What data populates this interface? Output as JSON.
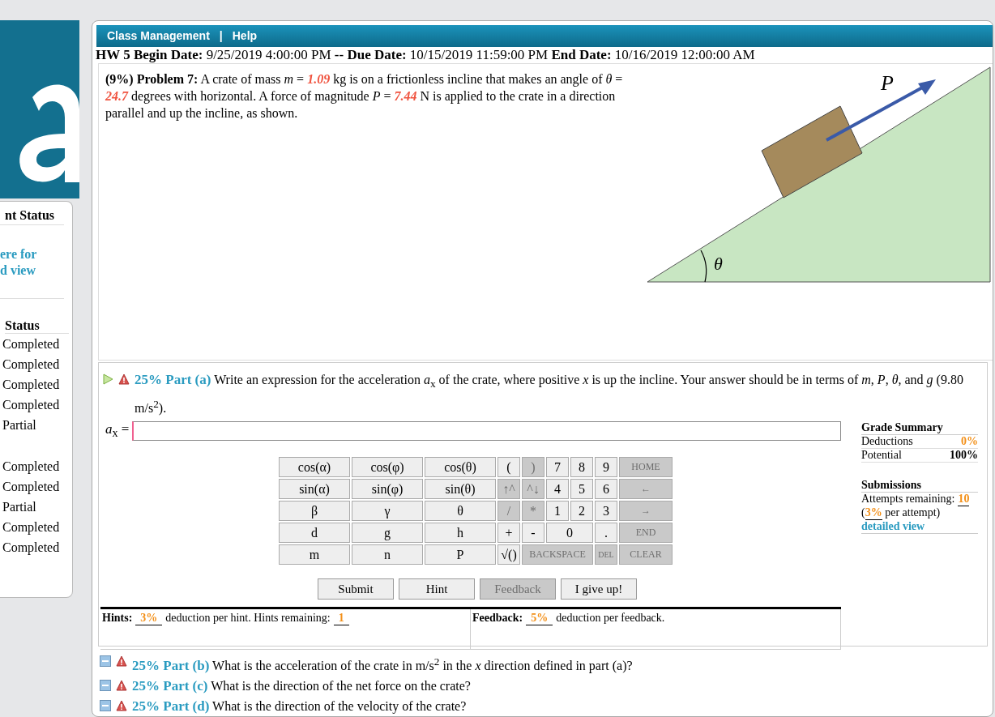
{
  "nav": {
    "items": [
      "Class Management",
      "Help"
    ],
    "separator": "|"
  },
  "sidebar": {
    "heading": "nt Status",
    "link_lines": [
      "ere for",
      "d view"
    ],
    "status_heading": "Status",
    "status_groups": [
      [
        "Completed",
        "Completed",
        "Completed",
        "Completed",
        "Partial"
      ],
      [
        "Completed",
        "Completed",
        "Partial",
        "Completed",
        "Completed"
      ]
    ]
  },
  "hw_header": "**HW 5 Begin Date:** 9/25/2019 4:00:00 PM **-- Due Date:** 10/15/2019 11:59:00 PM **End Date:** 10/16/2019 12:00:00 AM",
  "problem": {
    "segments": [
      {
        "kind": "text",
        "text": "**(9%)  Problem 7:**   A crate of mass *m* = "
      },
      {
        "kind": "given",
        "text": "1.09"
      },
      {
        "kind": "text",
        "text": " kg is on a frictionless incline that makes an angle of *θ* = "
      },
      {
        "kind": "given",
        "text": "24.7"
      },
      {
        "kind": "text",
        "text": " degrees with horizontal. A force of magnitude *P* = "
      },
      {
        "kind": "given",
        "text": "7.44"
      },
      {
        "kind": "text",
        "text": " N is applied to the crate in a direction parallel and up the incline, as shown."
      }
    ],
    "diagram": {
      "force_label": "P",
      "angle_label": "θ"
    }
  },
  "parts": [
    {
      "title": "25% Part (a)",
      "prompt": "Write an expression for the acceleration *a*$_{x}$ of the crate, where positive *x* is up the incline. Your answer should be in terms of *m*, *P*, *θ*, and *g* (9.80 m/s$^{2}$).",
      "expanded": true,
      "answer": {
        "label": "*a*$_{x}$ =",
        "keypad": [
          [
            {
              "label": "cos(α)",
              "kind": "key",
              "disabled": false
            },
            {
              "label": "cos(φ)",
              "kind": "key",
              "disabled": false
            },
            {
              "label": "cos(θ)",
              "kind": "key",
              "disabled": false
            },
            {
              "label": "(",
              "kind": "key",
              "disabled": false
            },
            {
              "label": ")",
              "kind": "key",
              "disabled": true
            },
            {
              "label": "7",
              "kind": "key",
              "disabled": false
            },
            {
              "label": "8",
              "kind": "key",
              "disabled": false
            },
            {
              "label": "9",
              "kind": "key",
              "disabled": false
            },
            {
              "label": "HOME",
              "kind": "word",
              "disabled": true
            }
          ],
          [
            {
              "label": "sin(α)",
              "kind": "key",
              "disabled": false
            },
            {
              "label": "sin(φ)",
              "kind": "key",
              "disabled": false
            },
            {
              "label": "sin(θ)",
              "kind": "key",
              "disabled": false
            },
            {
              "label": "↑^",
              "kind": "key",
              "disabled": true
            },
            {
              "label": "^↓",
              "kind": "key",
              "disabled": true
            },
            {
              "label": "4",
              "kind": "key",
              "disabled": false
            },
            {
              "label": "5",
              "kind": "key",
              "disabled": false
            },
            {
              "label": "6",
              "kind": "key",
              "disabled": false
            },
            {
              "label": "←",
              "kind": "word",
              "disabled": true
            }
          ],
          [
            {
              "label": "β",
              "kind": "key",
              "disabled": false
            },
            {
              "label": "γ",
              "kind": "key",
              "disabled": false
            },
            {
              "label": "θ",
              "kind": "key",
              "disabled": false
            },
            {
              "label": "/",
              "kind": "key",
              "disabled": true
            },
            {
              "label": "*",
              "kind": "key",
              "disabled": true
            },
            {
              "label": "1",
              "kind": "key",
              "disabled": false
            },
            {
              "label": "2",
              "kind": "key",
              "disabled": false
            },
            {
              "label": "3",
              "kind": "key",
              "disabled": false
            },
            {
              "label": "→",
              "kind": "word",
              "disabled": true
            }
          ],
          [
            {
              "label": "d",
              "kind": "key",
              "disabled": false
            },
            {
              "label": "g",
              "kind": "key",
              "disabled": false
            },
            {
              "label": "h",
              "kind": "key",
              "disabled": false
            },
            {
              "label": "+",
              "kind": "key",
              "disabled": false
            },
            {
              "label": "-",
              "kind": "key",
              "disabled": false
            },
            {
              "label": "0",
              "kind": "double",
              "disabled": false
            },
            {
              "label": ".",
              "kind": "key",
              "disabled": false
            },
            {
              "label": "END",
              "kind": "word",
              "disabled": true
            }
          ],
          [
            {
              "label": "m",
              "kind": "key",
              "disabled": false
            },
            {
              "label": "n",
              "kind": "key",
              "disabled": false
            },
            {
              "label": "P",
              "kind": "key",
              "disabled": false
            },
            {
              "label": "√()",
              "kind": "key",
              "disabled": false
            },
            {
              "label": "BACKSPACE",
              "kind": "triple_word",
              "disabled": true
            },
            {
              "label": "DEL",
              "kind": "tiny_word",
              "disabled": true
            },
            {
              "label": "CLEAR",
              "kind": "word",
              "disabled": true
            }
          ]
        ],
        "buttons": [
          {
            "label": "Submit",
            "disabled": false
          },
          {
            "label": "Hint",
            "disabled": false
          },
          {
            "label": "Feedback",
            "disabled": true
          },
          {
            "label": "I give up!",
            "disabled": false
          }
        ],
        "hints": {
          "label": "Hints:",
          "deduction": "3%",
          "text": "deduction per hint. Hints remaining:",
          "remaining": "1"
        },
        "feedback": {
          "label": "Feedback:",
          "deduction": "5%",
          "text": "deduction per feedback."
        },
        "grade_summary": {
          "heading": "Grade Summary",
          "rows": [
            {
              "label": "Deductions",
              "value": "0%",
              "kind": "highlight"
            },
            {
              "label": "Potential",
              "value": "100%",
              "kind": "bold"
            }
          ]
        },
        "submissions": {
          "heading": "Submissions",
          "attempts_label": "Attempts remaining:",
          "attempts": "10",
          "open": "(",
          "per_attempt": "3%",
          "per_attempt_text": "per attempt)",
          "link": "detailed view"
        }
      }
    },
    {
      "title": "25% Part (b)",
      "prompt": "What is the acceleration of the crate in m/s$^{2}$ in the *x* direction defined in part (a)?",
      "expanded": false
    },
    {
      "title": "25% Part (c)",
      "prompt": "What is the direction of the net force on the crate?",
      "expanded": false
    },
    {
      "title": "25% Part (d)",
      "prompt": "What is the direction of the velocity of the crate?",
      "expanded": false
    }
  ]
}
